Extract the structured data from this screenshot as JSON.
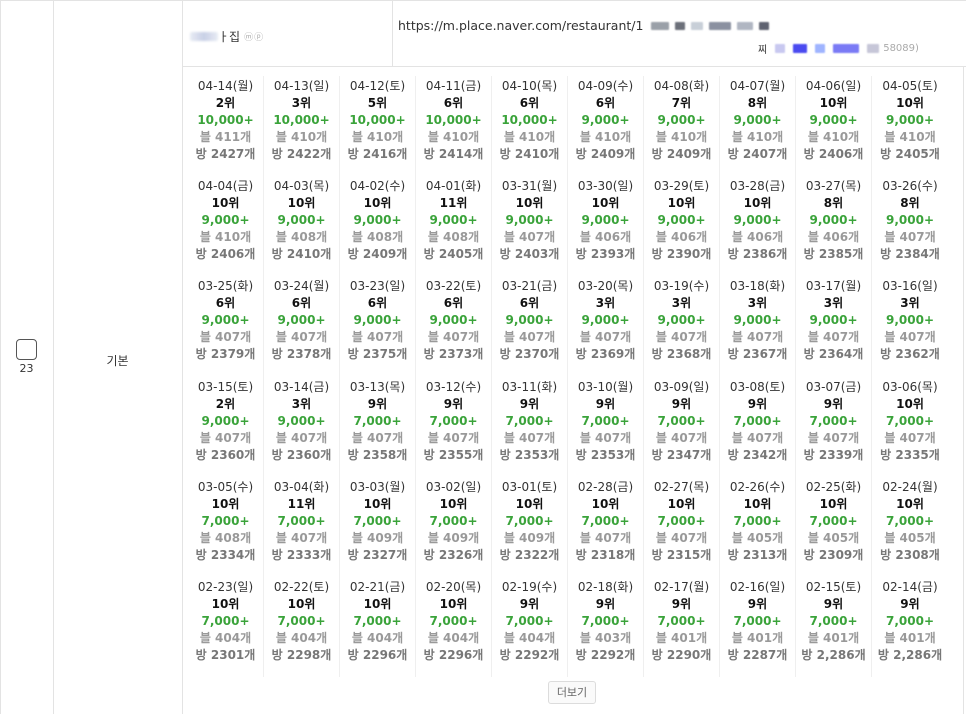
{
  "row": {
    "number": "23",
    "type_label": "기본"
  },
  "store": {
    "name_visible": "ㅏ집",
    "badges": "ⓜⓟ"
  },
  "url": {
    "text": "https://m.place.naver.com/restaurant/1",
    "id_prefix": "찌",
    "id_suffix": "58089)"
  },
  "more_button": "더보기",
  "colors": {
    "volume": "#3aa33a",
    "muted": "#999999",
    "border": "#e3e3e3"
  },
  "days": [
    {
      "date": "04-14(월)",
      "rank": "2위",
      "volume": "10,000+",
      "blog": "블 411개",
      "room": "방 2427개"
    },
    {
      "date": "04-13(일)",
      "rank": "3위",
      "volume": "10,000+",
      "blog": "블 410개",
      "room": "방 2422개"
    },
    {
      "date": "04-12(토)",
      "rank": "5위",
      "volume": "10,000+",
      "blog": "블 410개",
      "room": "방 2416개"
    },
    {
      "date": "04-11(금)",
      "rank": "6위",
      "volume": "10,000+",
      "blog": "블 410개",
      "room": "방 2414개"
    },
    {
      "date": "04-10(목)",
      "rank": "6위",
      "volume": "10,000+",
      "blog": "블 410개",
      "room": "방 2410개"
    },
    {
      "date": "04-09(수)",
      "rank": "6위",
      "volume": "9,000+",
      "blog": "블 410개",
      "room": "방 2409개"
    },
    {
      "date": "04-08(화)",
      "rank": "7위",
      "volume": "9,000+",
      "blog": "블 410개",
      "room": "방 2409개"
    },
    {
      "date": "04-07(월)",
      "rank": "8위",
      "volume": "9,000+",
      "blog": "블 410개",
      "room": "방 2407개"
    },
    {
      "date": "04-06(일)",
      "rank": "10위",
      "volume": "9,000+",
      "blog": "블 410개",
      "room": "방 2406개"
    },
    {
      "date": "04-05(토)",
      "rank": "10위",
      "volume": "9,000+",
      "blog": "블 410개",
      "room": "방 2405개"
    },
    {
      "date": "04-04(금)",
      "rank": "10위",
      "volume": "9,000+",
      "blog": "블 410개",
      "room": "방 2406개"
    },
    {
      "date": "04-03(목)",
      "rank": "10위",
      "volume": "9,000+",
      "blog": "블 408개",
      "room": "방 2410개"
    },
    {
      "date": "04-02(수)",
      "rank": "10위",
      "volume": "9,000+",
      "blog": "블 408개",
      "room": "방 2409개"
    },
    {
      "date": "04-01(화)",
      "rank": "11위",
      "volume": "9,000+",
      "blog": "블 408개",
      "room": "방 2405개"
    },
    {
      "date": "03-31(월)",
      "rank": "10위",
      "volume": "9,000+",
      "blog": "블 407개",
      "room": "방 2403개"
    },
    {
      "date": "03-30(일)",
      "rank": "10위",
      "volume": "9,000+",
      "blog": "블 406개",
      "room": "방 2393개"
    },
    {
      "date": "03-29(토)",
      "rank": "10위",
      "volume": "9,000+",
      "blog": "블 406개",
      "room": "방 2390개"
    },
    {
      "date": "03-28(금)",
      "rank": "10위",
      "volume": "9,000+",
      "blog": "블 406개",
      "room": "방 2386개"
    },
    {
      "date": "03-27(목)",
      "rank": "8위",
      "volume": "9,000+",
      "blog": "블 406개",
      "room": "방 2385개"
    },
    {
      "date": "03-26(수)",
      "rank": "8위",
      "volume": "9,000+",
      "blog": "블 407개",
      "room": "방 2384개"
    },
    {
      "date": "03-25(화)",
      "rank": "6위",
      "volume": "9,000+",
      "blog": "블 407개",
      "room": "방 2379개"
    },
    {
      "date": "03-24(월)",
      "rank": "6위",
      "volume": "9,000+",
      "blog": "블 407개",
      "room": "방 2378개"
    },
    {
      "date": "03-23(일)",
      "rank": "6위",
      "volume": "9,000+",
      "blog": "블 407개",
      "room": "방 2375개"
    },
    {
      "date": "03-22(토)",
      "rank": "6위",
      "volume": "9,000+",
      "blog": "블 407개",
      "room": "방 2373개"
    },
    {
      "date": "03-21(금)",
      "rank": "6위",
      "volume": "9,000+",
      "blog": "블 407개",
      "room": "방 2370개"
    },
    {
      "date": "03-20(목)",
      "rank": "3위",
      "volume": "9,000+",
      "blog": "블 407개",
      "room": "방 2369개"
    },
    {
      "date": "03-19(수)",
      "rank": "3위",
      "volume": "9,000+",
      "blog": "블 407개",
      "room": "방 2368개"
    },
    {
      "date": "03-18(화)",
      "rank": "3위",
      "volume": "9,000+",
      "blog": "블 407개",
      "room": "방 2367개"
    },
    {
      "date": "03-17(월)",
      "rank": "3위",
      "volume": "9,000+",
      "blog": "블 407개",
      "room": "방 2364개"
    },
    {
      "date": "03-16(일)",
      "rank": "3위",
      "volume": "9,000+",
      "blog": "블 407개",
      "room": "방 2362개"
    },
    {
      "date": "03-15(토)",
      "rank": "2위",
      "volume": "9,000+",
      "blog": "블 407개",
      "room": "방 2360개"
    },
    {
      "date": "03-14(금)",
      "rank": "3위",
      "volume": "9,000+",
      "blog": "블 407개",
      "room": "방 2360개"
    },
    {
      "date": "03-13(목)",
      "rank": "9위",
      "volume": "7,000+",
      "blog": "블 407개",
      "room": "방 2358개"
    },
    {
      "date": "03-12(수)",
      "rank": "9위",
      "volume": "7,000+",
      "blog": "블 407개",
      "room": "방 2355개"
    },
    {
      "date": "03-11(화)",
      "rank": "9위",
      "volume": "7,000+",
      "blog": "블 407개",
      "room": "방 2353개"
    },
    {
      "date": "03-10(월)",
      "rank": "9위",
      "volume": "7,000+",
      "blog": "블 407개",
      "room": "방 2353개"
    },
    {
      "date": "03-09(일)",
      "rank": "9위",
      "volume": "7,000+",
      "blog": "블 407개",
      "room": "방 2347개"
    },
    {
      "date": "03-08(토)",
      "rank": "9위",
      "volume": "7,000+",
      "blog": "블 407개",
      "room": "방 2342개"
    },
    {
      "date": "03-07(금)",
      "rank": "9위",
      "volume": "7,000+",
      "blog": "블 407개",
      "room": "방 2339개"
    },
    {
      "date": "03-06(목)",
      "rank": "10위",
      "volume": "7,000+",
      "blog": "블 407개",
      "room": "방 2335개"
    },
    {
      "date": "03-05(수)",
      "rank": "10위",
      "volume": "7,000+",
      "blog": "블 408개",
      "room": "방 2334개"
    },
    {
      "date": "03-04(화)",
      "rank": "11위",
      "volume": "7,000+",
      "blog": "블 407개",
      "room": "방 2333개"
    },
    {
      "date": "03-03(월)",
      "rank": "10위",
      "volume": "7,000+",
      "blog": "블 409개",
      "room": "방 2327개"
    },
    {
      "date": "03-02(일)",
      "rank": "10위",
      "volume": "7,000+",
      "blog": "블 409개",
      "room": "방 2326개"
    },
    {
      "date": "03-01(토)",
      "rank": "10위",
      "volume": "7,000+",
      "blog": "블 409개",
      "room": "방 2322개"
    },
    {
      "date": "02-28(금)",
      "rank": "10위",
      "volume": "7,000+",
      "blog": "블 407개",
      "room": "방 2318개"
    },
    {
      "date": "02-27(목)",
      "rank": "10위",
      "volume": "7,000+",
      "blog": "블 407개",
      "room": "방 2315개"
    },
    {
      "date": "02-26(수)",
      "rank": "10위",
      "volume": "7,000+",
      "blog": "블 405개",
      "room": "방 2313개"
    },
    {
      "date": "02-25(화)",
      "rank": "10위",
      "volume": "7,000+",
      "blog": "블 405개",
      "room": "방 2309개"
    },
    {
      "date": "02-24(월)",
      "rank": "10위",
      "volume": "7,000+",
      "blog": "블 405개",
      "room": "방 2308개"
    },
    {
      "date": "02-23(일)",
      "rank": "10위",
      "volume": "7,000+",
      "blog": "블 404개",
      "room": "방 2301개"
    },
    {
      "date": "02-22(토)",
      "rank": "10위",
      "volume": "7,000+",
      "blog": "블 404개",
      "room": "방 2298개"
    },
    {
      "date": "02-21(금)",
      "rank": "10위",
      "volume": "7,000+",
      "blog": "블 404개",
      "room": "방 2296개"
    },
    {
      "date": "02-20(목)",
      "rank": "10위",
      "volume": "7,000+",
      "blog": "블 404개",
      "room": "방 2296개"
    },
    {
      "date": "02-19(수)",
      "rank": "9위",
      "volume": "7,000+",
      "blog": "블 404개",
      "room": "방 2292개"
    },
    {
      "date": "02-18(화)",
      "rank": "9위",
      "volume": "7,000+",
      "blog": "블 403개",
      "room": "방 2292개"
    },
    {
      "date": "02-17(월)",
      "rank": "9위",
      "volume": "7,000+",
      "blog": "블 401개",
      "room": "방 2290개"
    },
    {
      "date": "02-16(일)",
      "rank": "9위",
      "volume": "7,000+",
      "blog": "블 401개",
      "room": "방 2287개"
    },
    {
      "date": "02-15(토)",
      "rank": "9위",
      "volume": "7,000+",
      "blog": "블 401개",
      "room": "방 2,286개"
    },
    {
      "date": "02-14(금)",
      "rank": "9위",
      "volume": "7,000+",
      "blog": "블 401개",
      "room": "방 2,286개"
    }
  ]
}
